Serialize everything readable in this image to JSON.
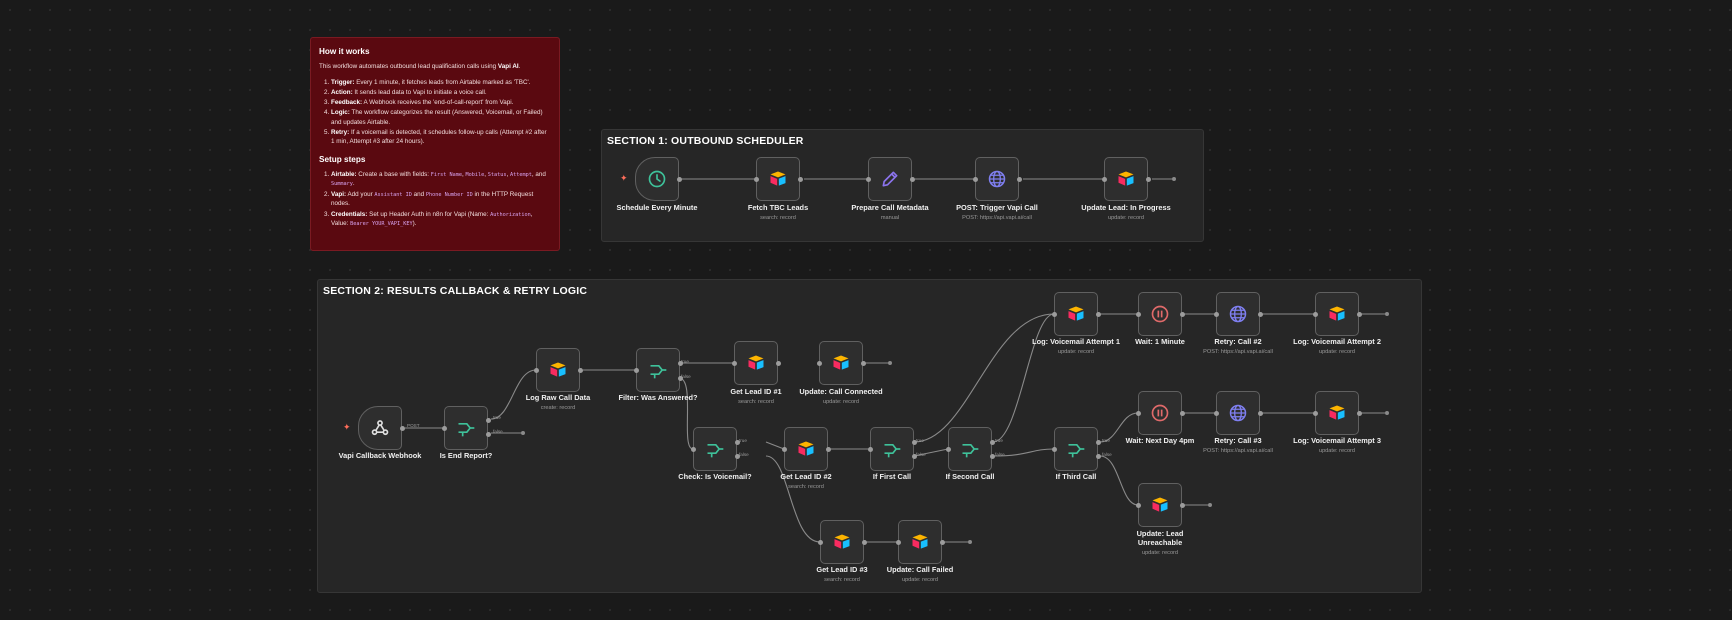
{
  "sticky": {
    "title": "How it works",
    "intro_pre": "This workflow automates outbound lead qualification calls using ",
    "intro_bold": "Vapi AI",
    "intro_post": ".",
    "steps": [
      {
        "bold": "Trigger:",
        "text": " Every 1 minute, it fetches leads from Airtable marked as 'TBC'."
      },
      {
        "bold": "Action:",
        "text": " It sends lead data to Vapi to initiate a voice call."
      },
      {
        "bold": "Feedback:",
        "text": " A Webhook receives the 'end-of-call-report' from Vapi."
      },
      {
        "bold": "Logic:",
        "text": " The workflow categorizes the result (Answered, Voicemail, or Failed) and updates Airtable."
      },
      {
        "bold": "Retry:",
        "text": " If a voicemail is detected, it schedules follow-up calls (Attempt #2 after 1 min, Attempt #3 after 24 hours)."
      }
    ],
    "setup_title": "Setup steps",
    "setup": {
      "airtable_bold": "Airtable:",
      "airtable_text": " Create a base with fields: ",
      "airtable_fields": [
        "First Name",
        "Mobile",
        "Status",
        "Attempt"
      ],
      "airtable_and": ", and",
      "airtable_last": "Summary",
      "vapi_bold": "Vapi:",
      "vapi_text1": " Add your ",
      "vapi_code1": "Assistant ID",
      "vapi_and": " and ",
      "vapi_code2": "Phone Number ID",
      "vapi_text2": " in the HTTP Request nodes.",
      "cred_bold": "Credentials:",
      "cred_text1": " Set up Header Auth in n8n for Vapi (Name: ",
      "cred_code1": "Authorization",
      "cred_text2": ", Value: ",
      "cred_code2": "Bearer YOUR_VAPI_KEY",
      "cred_text3": ")."
    }
  },
  "sections": {
    "s1": {
      "title": "SECTION 1: OUTBOUND SCHEDULER"
    },
    "s2": {
      "title": "SECTION 2: RESULTS CALLBACK & RETRY LOGIC"
    }
  },
  "nodes": {
    "schedule": {
      "label": "Schedule Every Minute",
      "sub": "",
      "icon": "clock-icon"
    },
    "fetch": {
      "label": "Fetch TBC Leads",
      "sub": "search: record",
      "icon": "airtable-icon"
    },
    "prepare": {
      "label": "Prepare Call Metadata",
      "sub": "manual",
      "icon": "pencil-icon"
    },
    "trigger_call": {
      "label": "POST: Trigger Vapi Call",
      "sub": "POST: https://api.vapi.ai/call",
      "icon": "globe-icon"
    },
    "update_progress": {
      "label": "Update Lead: In Progress",
      "sub": "update: record",
      "icon": "airtable-icon"
    },
    "webhook": {
      "label": "Vapi Callback Webhook",
      "sub": "",
      "icon": "webhook-icon"
    },
    "is_end": {
      "label": "Is End Report?",
      "sub": "",
      "icon": "if-icon"
    },
    "log_raw": {
      "label": "Log Raw Call Data",
      "sub": "create: record",
      "icon": "airtable-icon"
    },
    "filter_answered": {
      "label": "Filter: Was Answered?",
      "sub": "",
      "icon": "if-icon"
    },
    "get_lead1": {
      "label": "Get Lead ID #1",
      "sub": "search: record",
      "icon": "airtable-icon"
    },
    "update_connected": {
      "label": "Update: Call Connected",
      "sub": "update: record",
      "icon": "airtable-icon"
    },
    "check_vm": {
      "label": "Check: Is Voicemail?",
      "sub": "",
      "icon": "if-icon"
    },
    "get_lead2": {
      "label": "Get Lead ID #2",
      "sub": "search: record",
      "icon": "airtable-icon"
    },
    "if_first": {
      "label": "If First Call",
      "sub": "",
      "icon": "if-icon"
    },
    "if_second": {
      "label": "If Second Call",
      "sub": "",
      "icon": "if-icon"
    },
    "if_third": {
      "label": "If Third Call",
      "sub": "",
      "icon": "if-icon"
    },
    "log_vm1": {
      "label": "Log: Voicemail Attempt 1",
      "sub": "update: record",
      "icon": "airtable-icon"
    },
    "wait1": {
      "label": "Wait: 1 Minute",
      "sub": "",
      "icon": "pause-icon"
    },
    "retry2": {
      "label": "Retry: Call #2",
      "sub": "POST: https://api.vapi.ai/call",
      "icon": "globe-icon"
    },
    "log_vm2": {
      "label": "Log: Voicemail Attempt 2",
      "sub": "update: record",
      "icon": "airtable-icon"
    },
    "wait_day": {
      "label": "Wait: Next Day 4pm",
      "sub": "",
      "icon": "pause-icon"
    },
    "retry3": {
      "label": "Retry: Call #3",
      "sub": "POST: https://api.vapi.ai/call",
      "icon": "globe-icon"
    },
    "log_vm3": {
      "label": "Log: Voicemail Attempt 3",
      "sub": "update: record",
      "icon": "airtable-icon"
    },
    "unreachable": {
      "label": "Update: Lead Unreachable",
      "sub": "update: record",
      "icon": "airtable-icon"
    },
    "get_lead3": {
      "label": "Get Lead ID #3",
      "sub": "search: record",
      "icon": "airtable-icon"
    },
    "update_failed": {
      "label": "Update: Call Failed",
      "sub": "update: record",
      "icon": "airtable-icon"
    }
  },
  "edge_labels": {
    "post": "POST",
    "true": "true",
    "false": "false"
  },
  "colors": {
    "background": "#1a1a1a",
    "sticky_bg": "#5a0910",
    "section_bg": "#262626",
    "clock": "#3ec29a",
    "if": "#3ec29a",
    "globe": "#7f7ff0",
    "pencil": "#8c74ee",
    "pause": "#e06a6a",
    "trigger_bolt": "#ff6d5a"
  }
}
